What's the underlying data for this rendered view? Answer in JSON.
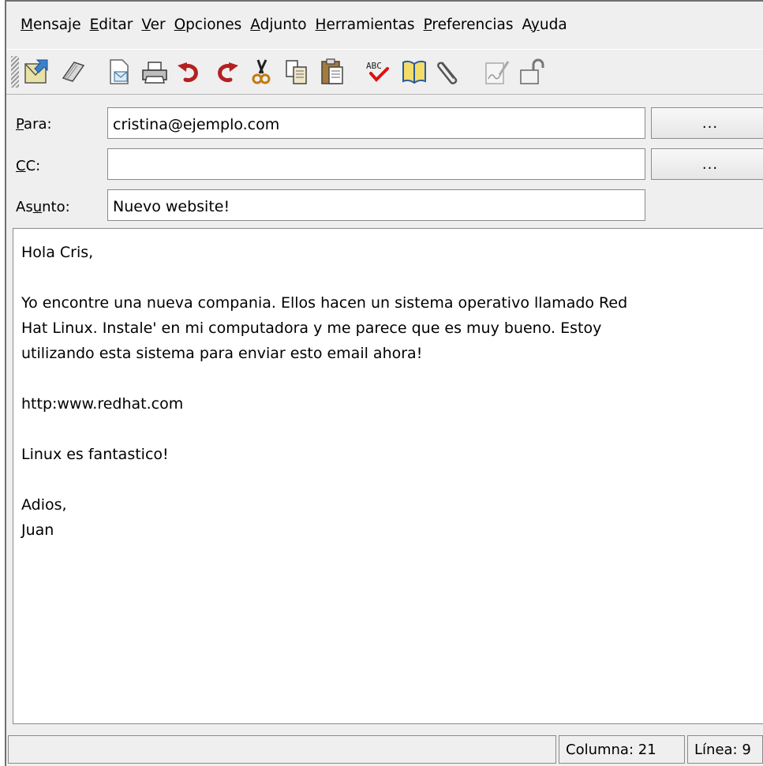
{
  "menu": [
    "Mensaje",
    "Editar",
    "Ver",
    "Opciones",
    "Adjunto",
    "Herramientas",
    "Preferencias",
    "Ayuda"
  ],
  "menu_mnemonic": [
    "M",
    "E",
    "V",
    "O",
    "A",
    "H",
    "P",
    "y"
  ],
  "toolbar": [
    "send-icon",
    "save-draft-icon",
    "new-icon",
    "print-icon",
    "undo-icon",
    "redo-icon",
    "cut-icon",
    "copy-icon",
    "paste-icon",
    "spellcheck-icon",
    "address-book-icon",
    "attach-icon",
    "sign-icon",
    "encrypt-lock-icon"
  ],
  "fields": {
    "to_label_m": "P",
    "to_label_rest": "ara:",
    "to_value": "cristina@ejemplo.com",
    "cc_label_m": "C",
    "cc_label_rest": "C:",
    "cc_value": "",
    "subject_label_a": "As",
    "subject_label_m": "u",
    "subject_label_b": "nto:",
    "subject_value": "Nuevo website!",
    "dots": "..."
  },
  "message": {
    "p1": "Hola Cris,",
    "p2": "Yo encontre una nueva compania. Ellos hacen un sistema operativo llamado Red\nHat Linux. Instale' en mi computadora y me parece que es muy bueno. Estoy\nutilizando esta sistema para enviar esto email ahora!",
    "p3": "http:www.redhat.com",
    "p4": "Linux es fantastico!",
    "p5": "Adios,\nJuan"
  },
  "status": {
    "message": "",
    "column": "Columna: 21",
    "line": "Línea: 9"
  }
}
